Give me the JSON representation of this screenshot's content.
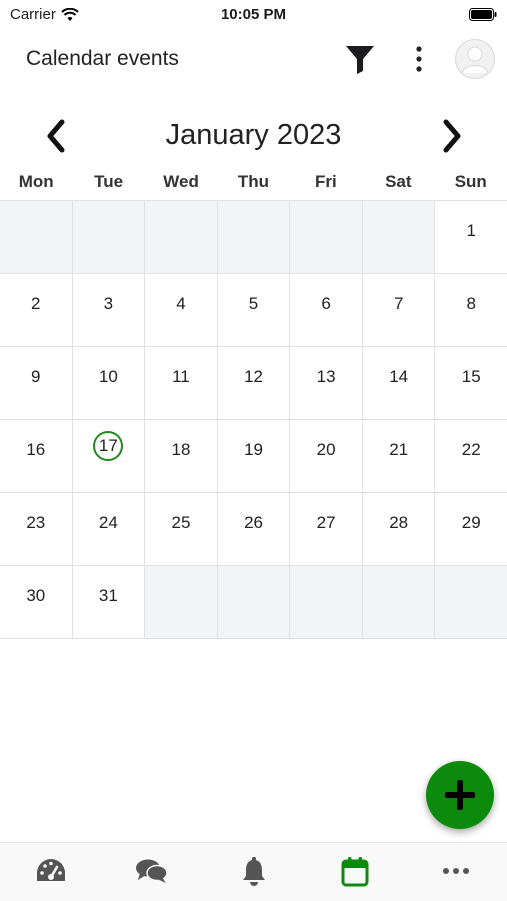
{
  "status_bar": {
    "carrier": "Carrier",
    "time": "10:05 PM"
  },
  "header": {
    "title": "Calendar events",
    "icons": [
      "filter-icon",
      "more-vertical-icon",
      "avatar"
    ]
  },
  "calendar": {
    "month_label": "January 2023",
    "weekdays": [
      "Mon",
      "Tue",
      "Wed",
      "Thu",
      "Fri",
      "Sat",
      "Sun"
    ],
    "weeks": [
      [
        "",
        "",
        "",
        "",
        "",
        "",
        "1"
      ],
      [
        "2",
        "3",
        "4",
        "5",
        "6",
        "7",
        "8"
      ],
      [
        "9",
        "10",
        "11",
        "12",
        "13",
        "14",
        "15"
      ],
      [
        "16",
        "17",
        "18",
        "19",
        "20",
        "21",
        "22"
      ],
      [
        "23",
        "24",
        "25",
        "26",
        "27",
        "28",
        "29"
      ],
      [
        "30",
        "31",
        "",
        "",
        "",
        "",
        ""
      ]
    ],
    "today": "17"
  },
  "fab": {
    "icon": "plus-icon"
  },
  "tabbar": {
    "tabs": [
      {
        "icon": "dashboard-icon",
        "active": false
      },
      {
        "icon": "chat-icon",
        "active": false
      },
      {
        "icon": "bell-icon",
        "active": false
      },
      {
        "icon": "calendar-icon",
        "active": true
      },
      {
        "icon": "more-horizontal-icon",
        "active": false
      }
    ]
  },
  "colors": {
    "accent": "#0b8a0b",
    "today_ring": "#1f8a1f",
    "empty_cell": "#f2f4f7",
    "icon_grey": "#555555"
  }
}
